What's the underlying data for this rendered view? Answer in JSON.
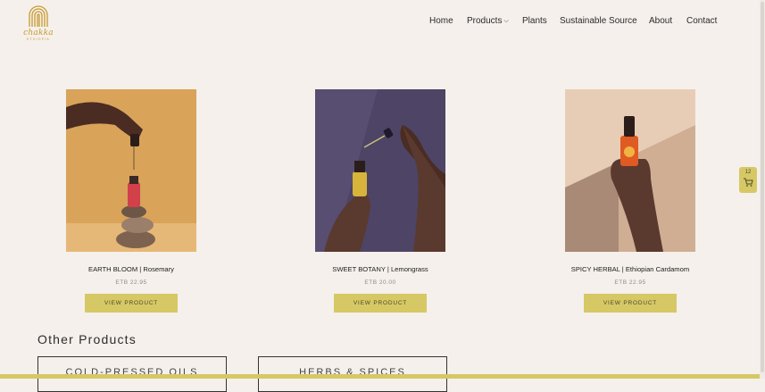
{
  "brand": {
    "name": "chakka",
    "tagline": "ETHIOPIA"
  },
  "nav": {
    "items": [
      {
        "label": "Home"
      },
      {
        "label": "Products"
      },
      {
        "label": "Plants"
      },
      {
        "label": "Sustainable Source"
      },
      {
        "label": "About"
      },
      {
        "label": "Contact"
      }
    ]
  },
  "products": [
    {
      "name": "EARTH BLOOM | Rosemary",
      "price": "ETB 22.95",
      "button": "VIEW PRODUCT"
    },
    {
      "name": "SWEET BOTANY | Lemongrass",
      "price": "ETB 20.00",
      "button": "VIEW PRODUCT"
    },
    {
      "name": "SPICY HERBAL | Ethiopian Cardamom",
      "price": "ETB 22.95",
      "button": "VIEW PRODUCT"
    }
  ],
  "other_products": {
    "title": "Other Products",
    "categories": [
      {
        "label": "COLD-PRESSED OILS"
      },
      {
        "label": "HERBS & SPICES"
      }
    ]
  },
  "cart": {
    "count": "12"
  },
  "colors": {
    "accent": "#d6c865",
    "background": "#f5f0eb",
    "logo": "#c79a2e"
  }
}
